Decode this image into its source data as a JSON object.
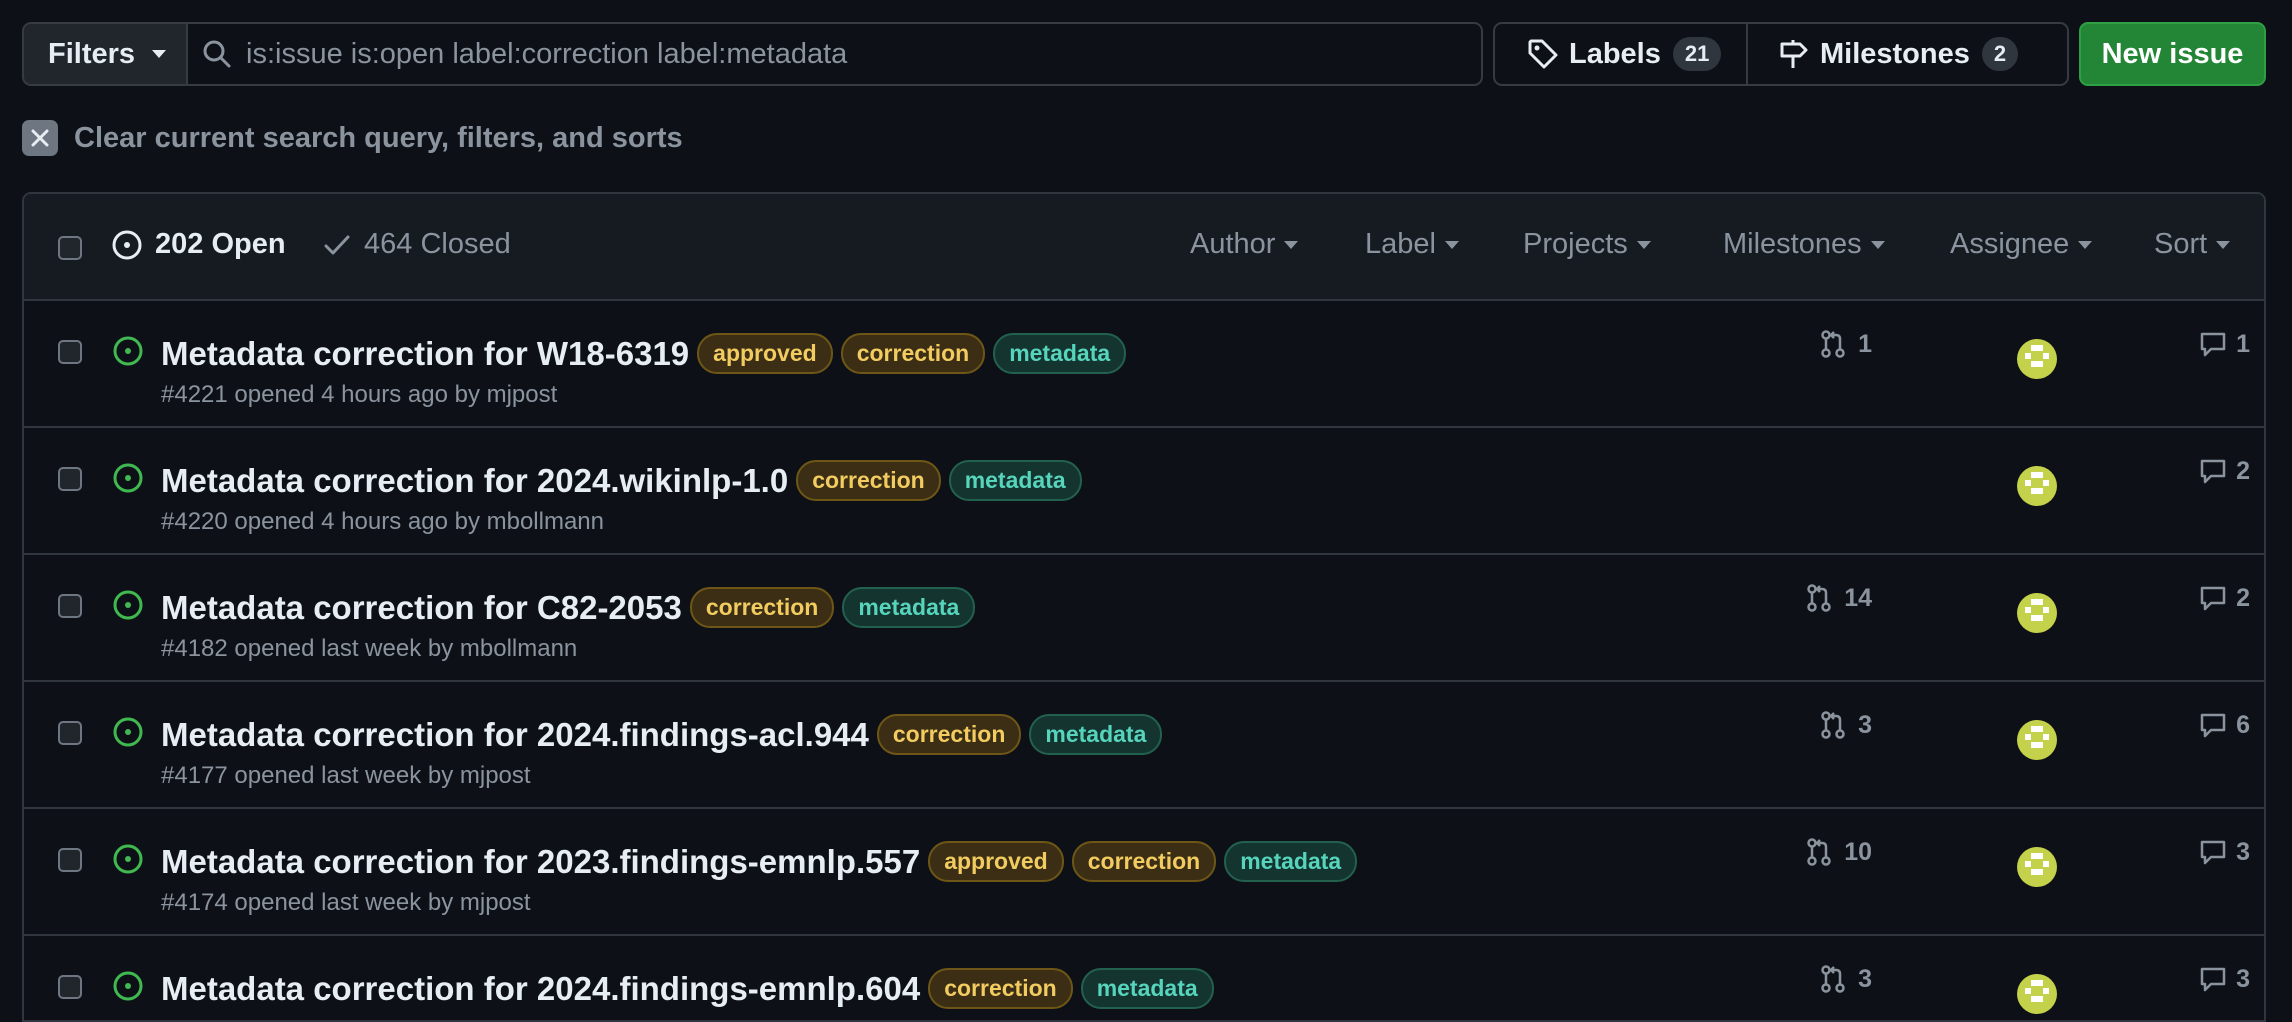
{
  "toolbar": {
    "filters_label": "Filters",
    "search_value": "is:issue is:open label:correction label:metadata",
    "labels_label": "Labels",
    "labels_count": "21",
    "milestones_label": "Milestones",
    "milestones_count": "2",
    "new_issue_label": "New issue"
  },
  "clear_query_label": "Clear current search query, filters, and sorts",
  "list_header": {
    "open_label": "202 Open",
    "closed_label": "464 Closed",
    "filters": [
      "Author",
      "Label",
      "Projects",
      "Milestones",
      "Assignee",
      "Sort"
    ]
  },
  "colors": {
    "background": "#0d1117",
    "accent_green": "#238636",
    "open_icon": "#3fb950",
    "label_yellow": "#f2cc60",
    "label_teal": "#56d4bc"
  },
  "issues": [
    {
      "title": "Metadata correction for W18-6319",
      "labels": [
        "approved",
        "correction",
        "metadata"
      ],
      "meta": "#4221 opened 4 hours ago by mjpost",
      "pr_count": "1",
      "comments": "1"
    },
    {
      "title": "Metadata correction for 2024.wikinlp-1.0",
      "labels": [
        "correction",
        "metadata"
      ],
      "meta": "#4220 opened 4 hours ago by mbollmann",
      "pr_count": "",
      "comments": "2"
    },
    {
      "title": "Metadata correction for C82-2053",
      "labels": [
        "correction",
        "metadata"
      ],
      "meta": "#4182 opened last week by mbollmann",
      "pr_count": "14",
      "comments": "2"
    },
    {
      "title": "Metadata correction for 2024.findings-acl.944",
      "labels": [
        "correction",
        "metadata"
      ],
      "meta": "#4177 opened last week by mjpost",
      "pr_count": "3",
      "comments": "6"
    },
    {
      "title": "Metadata correction for 2023.findings-emnlp.557",
      "labels": [
        "approved",
        "correction",
        "metadata"
      ],
      "meta": "#4174 opened last week by mjpost",
      "pr_count": "10",
      "comments": "3"
    },
    {
      "title": "Metadata correction for 2024.findings-emnlp.604",
      "labels": [
        "correction",
        "metadata"
      ],
      "meta": "",
      "pr_count": "3",
      "comments": "3"
    }
  ]
}
